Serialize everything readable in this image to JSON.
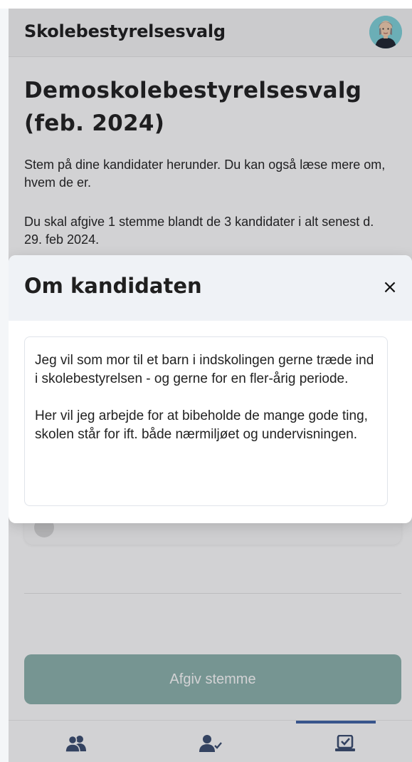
{
  "header": {
    "app_title": "Skolebestyrelsesvalg",
    "avatar_icon": "user-avatar-icon"
  },
  "page": {
    "title": "Demoskolebestyrelsesvalg (feb. 2024)",
    "intro_1": "Stem på dine kandidater herunder. Du kan også læse mere om, hvem de er.",
    "intro_2": "Du skal afgive 1 stemme blandt de 3 kandidater i alt senest d. 29. feb 2024."
  },
  "modal": {
    "title": "Om kandidaten",
    "close_label": "×",
    "paragraph_1": "Jeg vil som mor til et barn i indskolingen gerne træde ind i skolebestyrelsen - og gerne for en fler-årig periode.",
    "paragraph_2": "Her vil jeg arbejde for at bibeholde de mange gode ting, skolen står for ift. både nærmiljøet og undervisningen."
  },
  "actions": {
    "submit_label": "Afgiv stemme"
  },
  "bottom_nav": {
    "items": [
      {
        "icon": "candidates-icon",
        "active": false
      },
      {
        "icon": "user-check-icon",
        "active": false
      },
      {
        "icon": "ballot-check-icon",
        "active": true
      }
    ]
  },
  "colors": {
    "accent": "#3f63a6",
    "button": "#8cb3ad",
    "overlay": "rgba(28,28,40,0.2)"
  }
}
